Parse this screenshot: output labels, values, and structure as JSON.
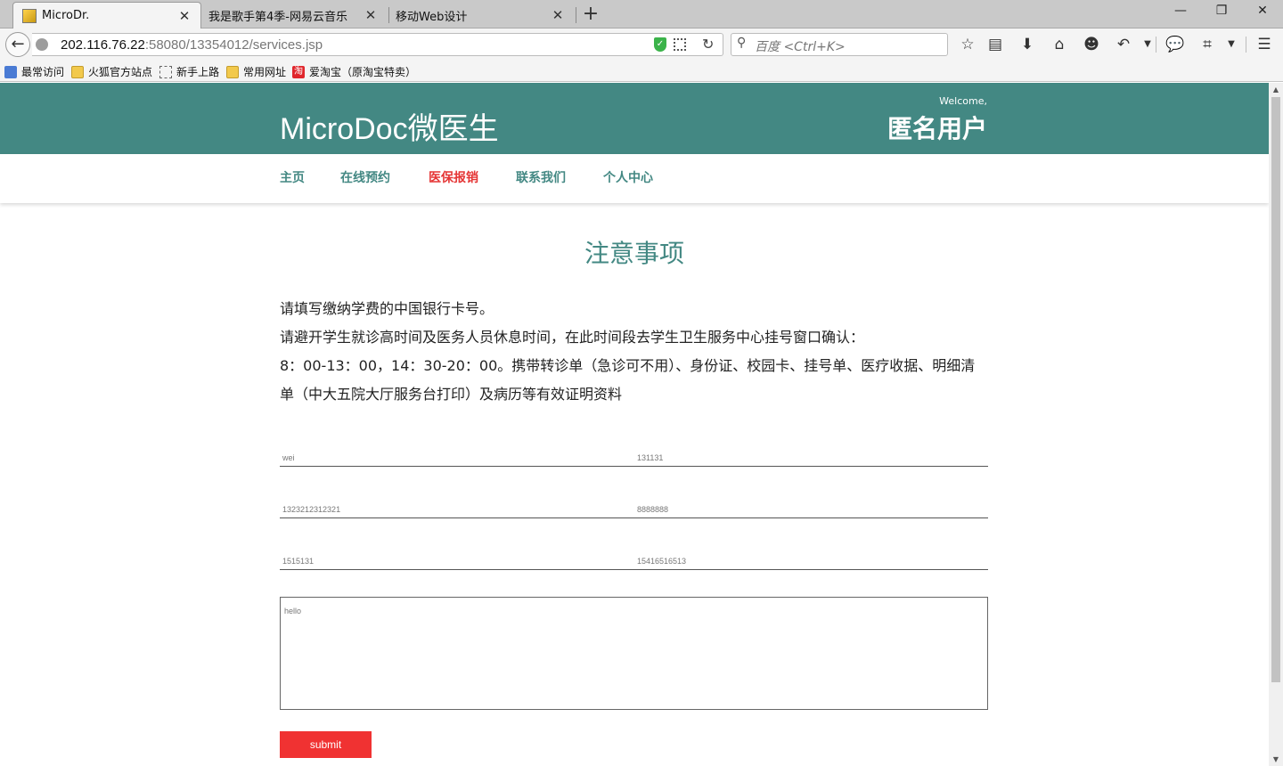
{
  "browser": {
    "tabs": [
      {
        "title": "MicroDr.",
        "active": true
      },
      {
        "title": "我是歌手第4季-网易云音乐",
        "active": false
      },
      {
        "title": "移动Web设计",
        "active": false
      }
    ],
    "url_host": "202.116.76.22",
    "url_rest": ":58080/13354012/services.jsp",
    "search_placeholder": "百度 <Ctrl+K>",
    "bookmarks": [
      "最常访问",
      "火狐官方站点",
      "新手上路",
      "常用网址",
      "爱淘宝（原淘宝特卖）"
    ],
    "taobao_icon_text": "淘"
  },
  "site": {
    "logo": "MicroDoc微医生",
    "welcome": "Welcome,",
    "username": "匿名用户",
    "nav": [
      "主页",
      "在线预约",
      "医保报销",
      "联系我们",
      "个人中心"
    ],
    "active_nav": "医保报销"
  },
  "notice": {
    "title": "注意事项",
    "lines": [
      "请填写缴纳学费的中国银行卡号。",
      "请避开学生就诊高时间及医务人员休息时间，在此时间段去学生卫生服务中心挂号窗口确认：",
      "8：00-13：00，14：30-20：00。携带转诊单（急诊可不用）、身份证、校园卡、挂号单、医疗收据、明细清单（中大五院大厅服务台打印）及病历等有效证明资料"
    ]
  },
  "form": {
    "fields": [
      "wei",
      "131131",
      "1323212312321",
      "8888888",
      "1515131",
      "15416516513"
    ],
    "message": "hello",
    "submit_label": "submit"
  },
  "colors": {
    "brand": "#438883",
    "accent": "#f03232"
  }
}
